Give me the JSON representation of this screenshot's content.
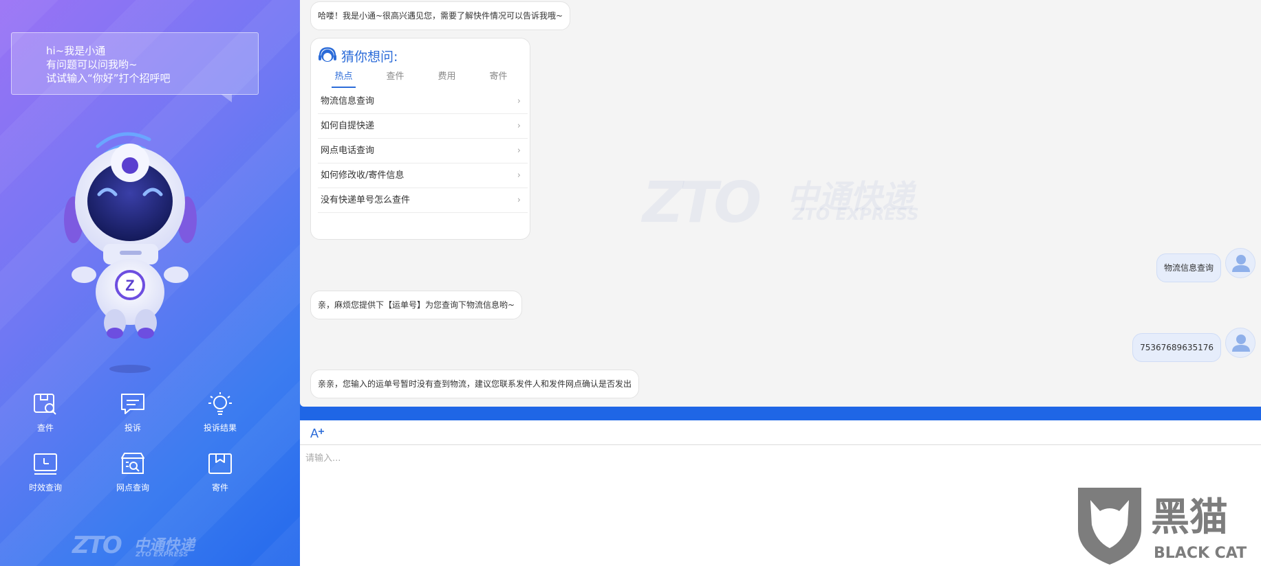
{
  "sidebar": {
    "greeting": {
      "line1": "hi~我是小通",
      "line2": "有问题可以问我哟~",
      "line3": "试试输入“你好”打个招呼吧"
    },
    "actions": [
      {
        "label": "查件",
        "icon": "search-package-icon"
      },
      {
        "label": "投诉",
        "icon": "message-icon"
      },
      {
        "label": "投诉结果",
        "icon": "lightbulb-icon"
      },
      {
        "label": "时效查询",
        "icon": "clock-icon"
      },
      {
        "label": "网点查询",
        "icon": "store-search-icon"
      },
      {
        "label": "寄件",
        "icon": "box-icon"
      }
    ],
    "logo": {
      "mark": "ZTO",
      "cn": "中通快递",
      "en": "ZTO EXPRESS"
    }
  },
  "chat": {
    "watermark": {
      "mark": "ZTO",
      "cn": "中通快递",
      "en": "ZTO EXPRESS"
    },
    "welcome": "哈喽！我是小通~很高兴遇见您，需要了解快件情况可以告诉我哦~",
    "guess": {
      "title": "猜你想问:",
      "tabs": [
        "热点",
        "查件",
        "费用",
        "寄件"
      ],
      "active_tab": "热点",
      "questions": [
        "物流信息查询",
        "如何自提快递",
        "网点电话查询",
        "如何修改收/寄件信息",
        "没有快递单号怎么查件"
      ]
    },
    "messages": [
      {
        "from": "user",
        "text": "物流信息查询"
      },
      {
        "from": "bot",
        "text": "亲，麻烦您提供下【运单号】为您查询下物流信息哟~"
      },
      {
        "from": "user",
        "text": "75367689635176"
      },
      {
        "from": "bot",
        "text": "亲亲，您输入的运单号暂时没有查到物流，建议您联系发件人和发件网点确认是否发出"
      }
    ]
  },
  "input": {
    "placeholder": "请输入..."
  },
  "badge": {
    "cn": "黑猫",
    "en": "BLACK CAT"
  },
  "colors": {
    "accent": "#2b6bd8",
    "sidebar_top": "#9a72f5",
    "sidebar_bottom": "#2469ec",
    "user_bubble": "#e6edfb"
  }
}
